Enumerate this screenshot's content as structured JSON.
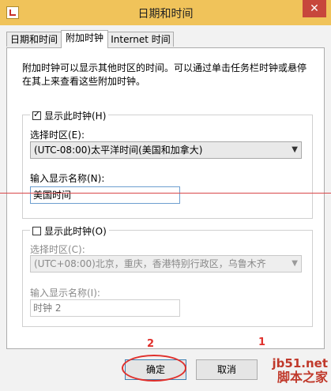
{
  "window": {
    "title": "日期和时间",
    "close_label": "✕"
  },
  "tabs": [
    {
      "label": "日期和时间",
      "active": false
    },
    {
      "label": "附加时钟",
      "active": true
    },
    {
      "label": "Internet 时间",
      "active": false
    }
  ],
  "description": "附加时钟可以显示其他时区的时间。可以通过单击任务栏时钟或悬停在其上来查看这些附加时钟。",
  "clock1": {
    "checkbox_label": "显示此时钟(H)",
    "checked": true,
    "timezone_label": "选择时区(E):",
    "timezone_value": "(UTC-08:00)太平洋时间(美国和加拿大)",
    "name_label": "输入显示名称(N):",
    "name_value": "美国时间"
  },
  "clock2": {
    "checkbox_label": "显示此时钟(O)",
    "checked": false,
    "timezone_label": "选择时区(C):",
    "timezone_value": "(UTC+08:00)北京，重庆，香港特别行政区，乌鲁木齐",
    "name_label": "输入显示名称(I):",
    "name_value": "时钟 2"
  },
  "buttons": {
    "ok": "确定",
    "cancel": "取消"
  },
  "annotations": {
    "marker1": "1",
    "marker2": "2"
  },
  "watermark": {
    "url": "jb51.net",
    "name": "脚本之家"
  },
  "colors": {
    "titlebar": "#f0c35a",
    "annotation_red": "#e0302c"
  }
}
